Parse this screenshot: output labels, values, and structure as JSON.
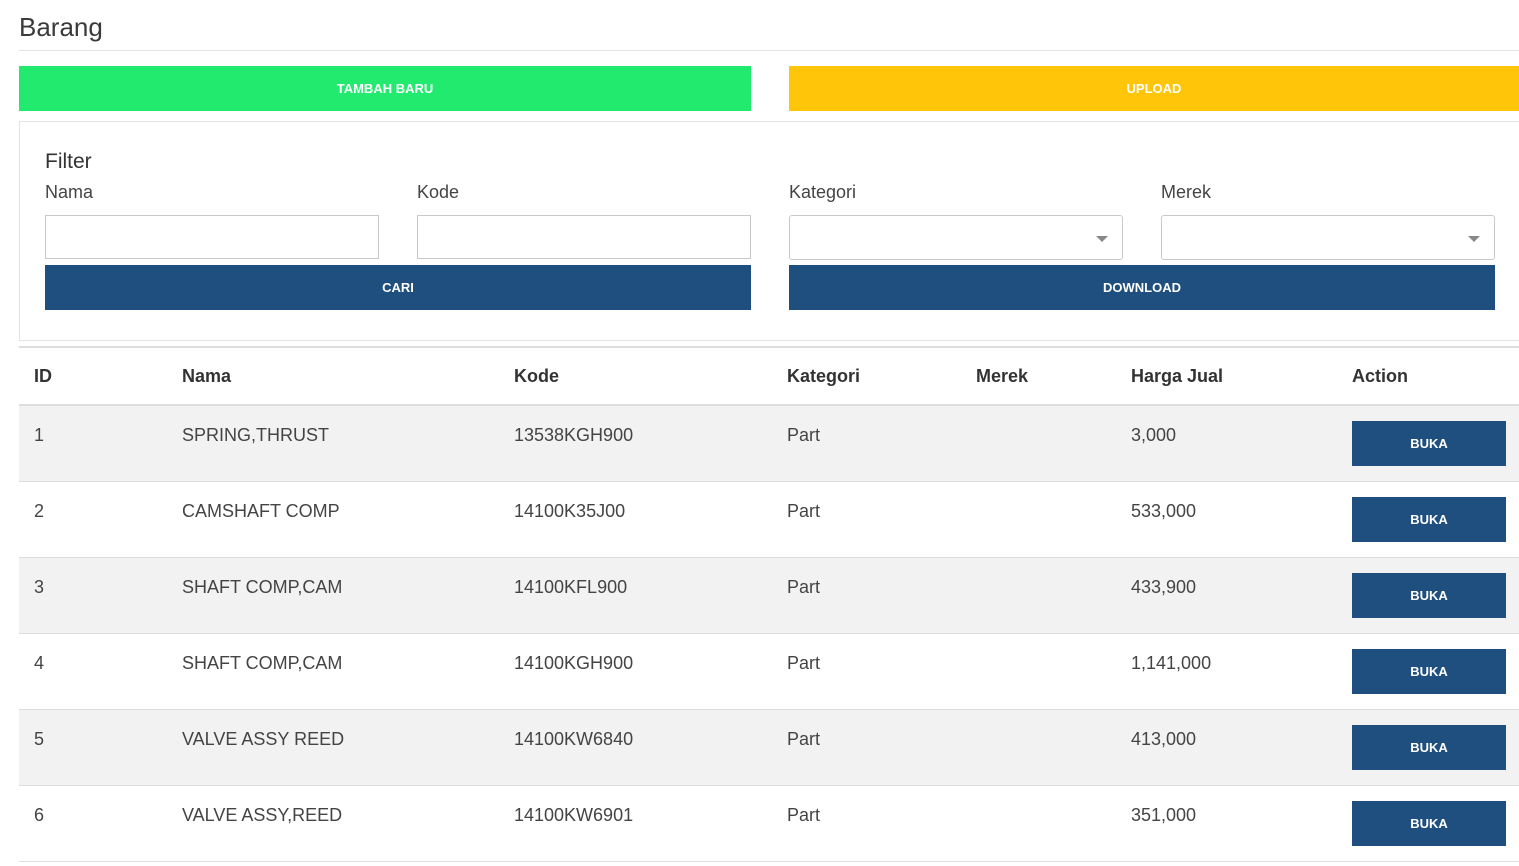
{
  "page": {
    "title": "Barang"
  },
  "toolbar": {
    "add_label": "TAMBAH BARU",
    "add_color": "#22ea6e",
    "upload_label": "UPLOAD",
    "upload_color": "#ffc508"
  },
  "filter": {
    "title": "Filter",
    "nama": {
      "label": "Nama",
      "value": ""
    },
    "kode": {
      "label": "Kode",
      "value": ""
    },
    "kategori": {
      "label": "Kategori",
      "selected": ""
    },
    "merek": {
      "label": "Merek",
      "selected": ""
    },
    "search_label": "CARI",
    "download_label": "DOWNLOAD",
    "button_color": "#1f4f7f"
  },
  "table": {
    "columns": [
      "ID",
      "Nama",
      "Kode",
      "Kategori",
      "Merek",
      "Harga Jual",
      "Action"
    ],
    "rows": [
      {
        "id": "1",
        "nama": "SPRING,THRUST",
        "kode": "13538KGH900",
        "kategori": "Part",
        "merek": "",
        "harga": "3,000",
        "action": "BUKA"
      },
      {
        "id": "2",
        "nama": "CAMSHAFT COMP",
        "kode": "14100K35J00",
        "kategori": "Part",
        "merek": "",
        "harga": "533,000",
        "action": "BUKA"
      },
      {
        "id": "3",
        "nama": "SHAFT COMP,CAM",
        "kode": "14100KFL900",
        "kategori": "Part",
        "merek": "",
        "harga": "433,900",
        "action": "BUKA"
      },
      {
        "id": "4",
        "nama": "SHAFT COMP,CAM",
        "kode": "14100KGH900",
        "kategori": "Part",
        "merek": "",
        "harga": "1,141,000",
        "action": "BUKA"
      },
      {
        "id": "5",
        "nama": "VALVE ASSY REED",
        "kode": "14100KW6840",
        "kategori": "Part",
        "merek": "",
        "harga": "413,000",
        "action": "BUKA"
      },
      {
        "id": "6",
        "nama": "VALVE ASSY,REED",
        "kode": "14100KW6901",
        "kategori": "Part",
        "merek": "",
        "harga": "351,000",
        "action": "BUKA"
      }
    ]
  }
}
